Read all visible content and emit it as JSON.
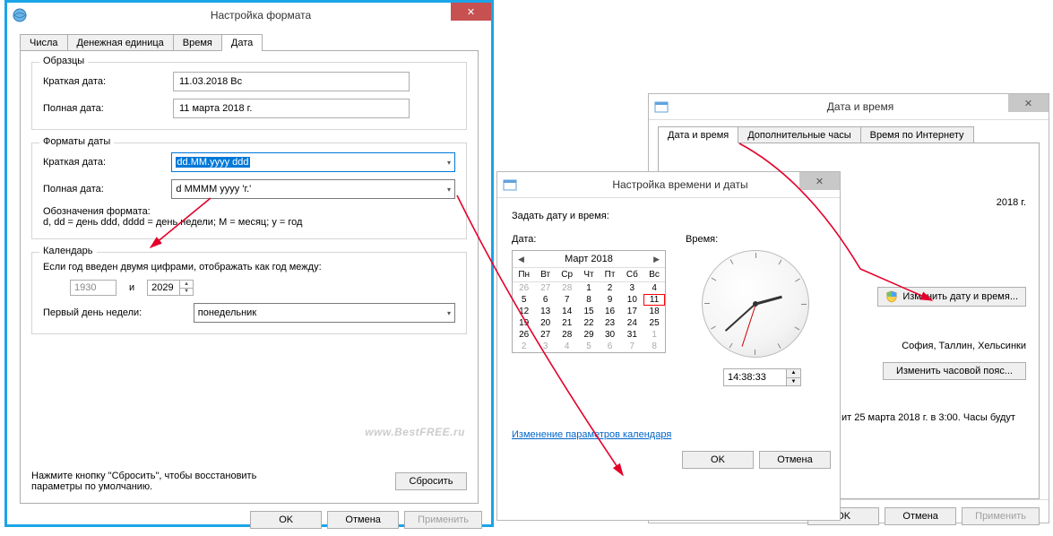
{
  "win1": {
    "title": "Настройка формата",
    "tabs": {
      "numbers": "Числа",
      "currency": "Денежная единица",
      "time": "Время",
      "date": "Дата"
    },
    "samples": {
      "legend": "Образцы",
      "short_lbl": "Краткая дата:",
      "short_val": "11.03.2018 Вс",
      "long_lbl": "Полная дата:",
      "long_val": "11 марта 2018 г."
    },
    "formats": {
      "legend": "Форматы даты",
      "short_lbl": "Краткая дата:",
      "short_val": "dd.MM.yyyy ddd",
      "long_lbl": "Полная дата:",
      "long_val": "d MMMM yyyy 'г.'",
      "notation_lbl": "Обозначения формата:",
      "notation_txt": "d, dd = день  ddd, dddd = день недели; M = месяц; y = год"
    },
    "calendar": {
      "legend": "Календарь",
      "year_lbl": "Если год введен двумя цифрами, отображать как год между:",
      "year_from": "1930",
      "and": "и",
      "year_to": "2029",
      "firstday_lbl": "Первый день недели:",
      "firstday_val": "понедельник"
    },
    "reset_hint": "Нажмите кнопку \"Сбросить\", чтобы восстановить параметры по умолчанию.",
    "reset_btn": "Сбросить",
    "ok": "OK",
    "cancel": "Отмена",
    "apply": "Применить",
    "watermark": "www.BestFREE.ru"
  },
  "win2": {
    "title": "Настройка времени и даты",
    "set_lbl": "Задать дату и время:",
    "date_lbl": "Дата:",
    "time_lbl": "Время:",
    "month": "Март 2018",
    "dow": [
      "Пн",
      "Вт",
      "Ср",
      "Чт",
      "Пт",
      "Сб",
      "Вс"
    ],
    "weeks": [
      [
        "26",
        "27",
        "28",
        "1",
        "2",
        "3",
        "4"
      ],
      [
        "5",
        "6",
        "7",
        "8",
        "9",
        "10",
        "11"
      ],
      [
        "12",
        "13",
        "14",
        "15",
        "16",
        "17",
        "18"
      ],
      [
        "19",
        "20",
        "21",
        "22",
        "23",
        "24",
        "25"
      ],
      [
        "26",
        "27",
        "28",
        "29",
        "30",
        "31",
        "1"
      ],
      [
        "2",
        "3",
        "4",
        "5",
        "6",
        "7",
        "8"
      ]
    ],
    "time_val": "14:38:33",
    "link": "Изменение параметров календаря",
    "ok": "OK",
    "cancel": "Отмена"
  },
  "win3": {
    "title": "Дата и время",
    "tabs": {
      "dt": "Дата и время",
      "extra": "Дополнительные часы",
      "net": "Время по Интернету"
    },
    "date_frag": "2018 г.",
    "change_btn": "Изменить дату и время...",
    "tz_frag": "София, Таллин, Хельсинки",
    "change_tz_btn": "Изменить часовой пояс...",
    "dst_frag": "ит 25 марта 2018 г. в 3:00. Часы будут",
    "ok": "OK",
    "cancel": "Отмена",
    "apply": "Применить"
  }
}
